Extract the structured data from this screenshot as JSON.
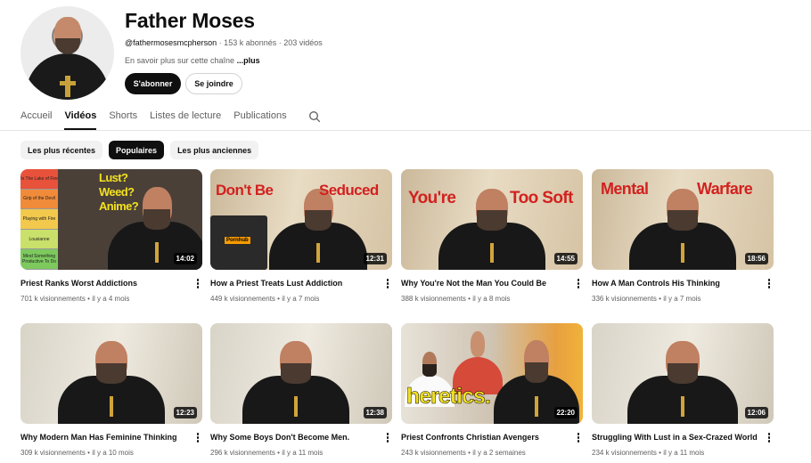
{
  "channel": {
    "name": "Father Moses",
    "handle": "@fathermosesmcpherson",
    "meta": " · 153 k abonnés · 203 vidéos",
    "description": "En savoir plus sur cette chaîne",
    "more": "...plus",
    "subscribe_label": "S'abonner",
    "join_label": "Se joindre"
  },
  "tabs": [
    {
      "label": "Accueil",
      "active": false
    },
    {
      "label": "Vidéos",
      "active": true
    },
    {
      "label": "Shorts",
      "active": false
    },
    {
      "label": "Listes de lecture",
      "active": false
    },
    {
      "label": "Publications",
      "active": false
    }
  ],
  "chips": [
    {
      "label": "Les plus récentes",
      "active": false
    },
    {
      "label": "Populaires",
      "active": true
    },
    {
      "label": "Les plus anciennes",
      "active": false
    }
  ],
  "videos": [
    {
      "title": "Priest Ranks Worst Addictions",
      "views": "701 k visionnements",
      "age": "il y a 4 mois",
      "duration": "14:02",
      "thumb_text": [
        "Lust?",
        "Weed?",
        "Anime?"
      ],
      "ladder": [
        "In The Lake of Fire",
        "Grip of the Devil",
        "Playing with Fire",
        "Lousianne",
        "Mind Something Productive To Do"
      ]
    },
    {
      "title": "How a Priest Treats Lust Addiction",
      "views": "449 k visionnements",
      "age": "il y a 7 mois",
      "duration": "12:31",
      "thumb_text": [
        "Don't Be",
        "Seduced"
      ],
      "laptop_logo": "Pornhub"
    },
    {
      "title": "Why You're Not the Man You Could Be",
      "views": "388 k visionnements",
      "age": "il y a 8 mois",
      "duration": "14:55",
      "thumb_text": [
        "You're",
        "Too Soft"
      ]
    },
    {
      "title": "How A Man Controls His Thinking",
      "views": "336 k visionnements",
      "age": "il y a 7 mois",
      "duration": "18:56",
      "thumb_text": [
        "Mental",
        "Warfare"
      ]
    },
    {
      "title": "Why Modern Man Has Feminine Thinking",
      "views": "309 k visionnements",
      "age": "il y a 10 mois",
      "duration": "12:23"
    },
    {
      "title": "Why Some Boys Don't Become Men.",
      "views": "296 k visionnements",
      "age": "il y a 11 mois",
      "duration": "12:38"
    },
    {
      "title": "Priest Confronts Christian Avengers",
      "views": "243 k visionnements",
      "age": "il y a 2 semaines",
      "duration": "22:20",
      "thumb_text": [
        "heretics."
      ]
    },
    {
      "title": "Struggling With Lust in a Sex-Crazed World",
      "views": "234 k visionnements",
      "age": "il y a 11 mois",
      "duration": "12:06"
    }
  ],
  "stats_sep": " • ",
  "colors": {
    "accent_red": "#d2211f",
    "subscribe_bg": "#0f0f0f",
    "heretics_yellow": "#f3e11f"
  }
}
